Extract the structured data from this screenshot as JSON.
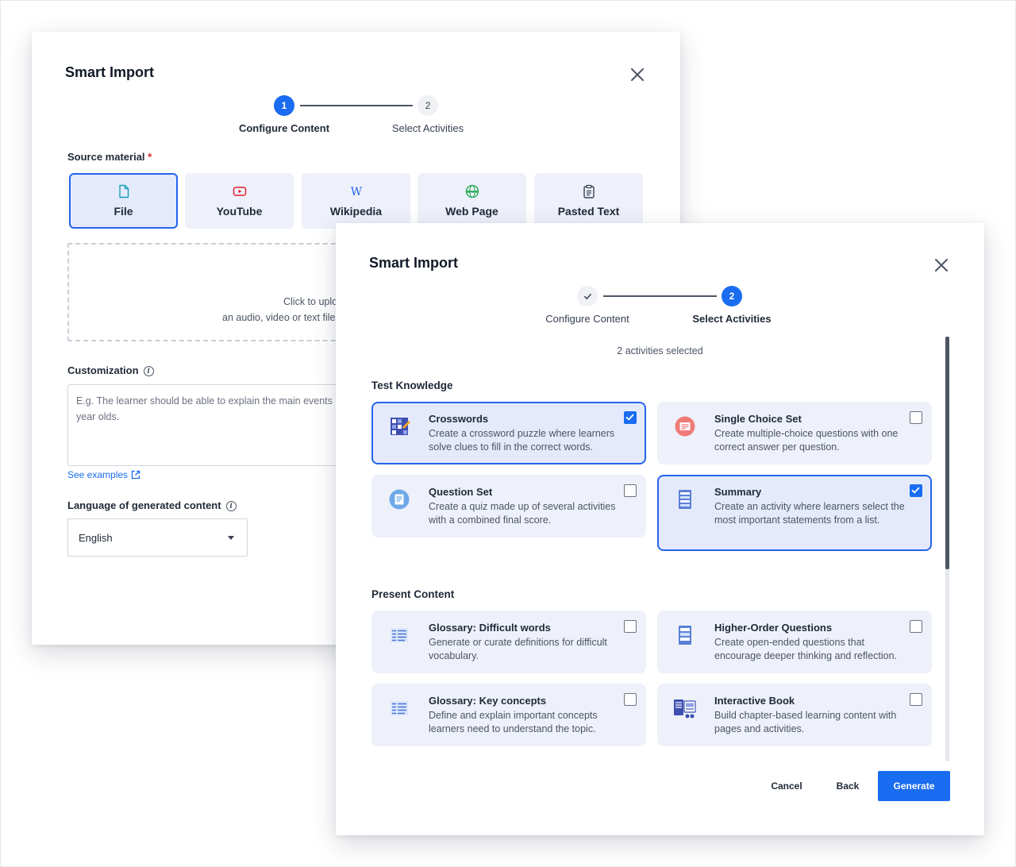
{
  "configure_dialog": {
    "title": "Smart Import",
    "steps": [
      {
        "number": "1",
        "label": "Configure Content"
      },
      {
        "number": "2",
        "label": "Select Activities"
      }
    ],
    "source_label": "Source material",
    "required_mark": "*",
    "sources": [
      {
        "label": "File",
        "icon": "file-icon",
        "selected": true
      },
      {
        "label": "YouTube",
        "icon": "youtube-icon",
        "selected": false
      },
      {
        "label": "Wikipedia",
        "icon": "wikipedia-icon",
        "selected": false
      },
      {
        "label": "Web Page",
        "icon": "globe-icon",
        "selected": false
      },
      {
        "label": "Pasted Text",
        "icon": "clipboard-icon",
        "selected": false
      }
    ],
    "dropzone_line1": "Click to uplo",
    "dropzone_line2": "an audio, video or text file",
    "customization_label": "Customization",
    "customization_placeholder": "E.g. The learner should be able to explain the main events",
    "customization_placeholder_line2": "year olds.",
    "see_examples": "See examples",
    "language_label": "Language of generated content",
    "language_value": "English"
  },
  "activities_dialog": {
    "title": "Smart Import",
    "steps": [
      {
        "number": "✓",
        "label": "Configure Content"
      },
      {
        "number": "2",
        "label": "Select Activities"
      }
    ],
    "selected_count": "2 activities selected",
    "groups": [
      {
        "title": "Test Knowledge",
        "activities": [
          {
            "title": "Crosswords",
            "description": "Create a crossword puzzle where learners solve clues to fill in the correct words.",
            "icon": "crossword-icon",
            "checked": true
          },
          {
            "title": "Single Choice Set",
            "description": "Create multiple-choice questions with one correct answer per question.",
            "icon": "single-choice-icon",
            "checked": false
          },
          {
            "title": "Question Set",
            "description": "Create a quiz made up of several activities with a combined final score.",
            "icon": "question-set-icon",
            "checked": false
          },
          {
            "title": "Summary",
            "description": "Create an activity where learners select the most important statements from a list.",
            "icon": "summary-icon",
            "checked": true
          }
        ]
      },
      {
        "title": "Present Content",
        "activities": [
          {
            "title": "Glossary: Difficult words",
            "description": "Generate or curate definitions for difficult vocabulary.",
            "icon": "glossary-icon",
            "checked": false
          },
          {
            "title": "Higher-Order Questions",
            "description": "Create open-ended questions that encourage deeper thinking and reflection.",
            "icon": "questions-doc-icon",
            "checked": false
          },
          {
            "title": "Glossary: Key concepts",
            "description": "Define and explain important concepts learners need to understand the topic.",
            "icon": "glossary-key-icon",
            "checked": false
          },
          {
            "title": "Interactive Book",
            "description": "Build chapter-based learning content with pages and activities.",
            "icon": "book-icon",
            "checked": false
          }
        ]
      }
    ],
    "buttons": {
      "cancel": "Cancel",
      "back": "Back",
      "generate": "Generate"
    }
  },
  "colors": {
    "accent": "#1a6cf0",
    "card_bg": "#eef1fa",
    "selected_border": "#2563eb"
  }
}
